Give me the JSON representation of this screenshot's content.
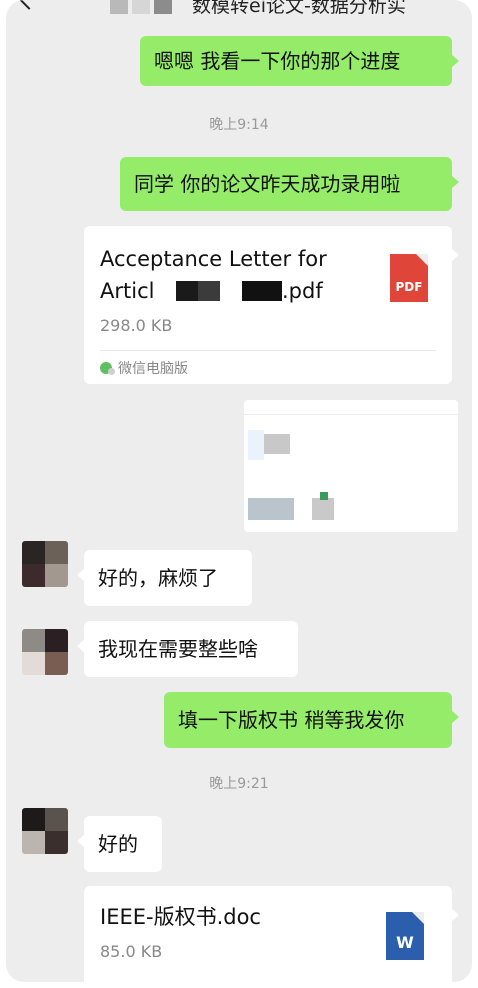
{
  "header": {
    "title": "数模转ei论文-数据分析实"
  },
  "messages": {
    "m1": {
      "text": "嗯嗯 我看一下你的那个进度"
    },
    "time1": "晚上9:14",
    "m2": {
      "text": "同学 你的论文昨天成功录用啦"
    },
    "file1": {
      "name_line1": "Acceptance Letter for",
      "name_line2_start": "Articl",
      "name_line2_end": ".pdf",
      "size": "298.0 KB",
      "icon_label": "PDF",
      "source": "微信电脑版"
    },
    "m3": {
      "text": "好的，麻烦了"
    },
    "m4": {
      "text": "我现在需要整些啥"
    },
    "m5": {
      "text": "填一下版权书 稍等我发你"
    },
    "time2": "晚上9:21",
    "m6": {
      "text": "好的"
    },
    "file2": {
      "name": "IEEE-版权书.doc",
      "size": "85.0 KB",
      "icon_label": "W"
    }
  },
  "colors": {
    "sent_bubble": "#95ec69",
    "received_bubble": "#ffffff",
    "chat_background": "#ededed",
    "pdf_icon": "#e0453a",
    "doc_icon": "#2b5fad"
  }
}
